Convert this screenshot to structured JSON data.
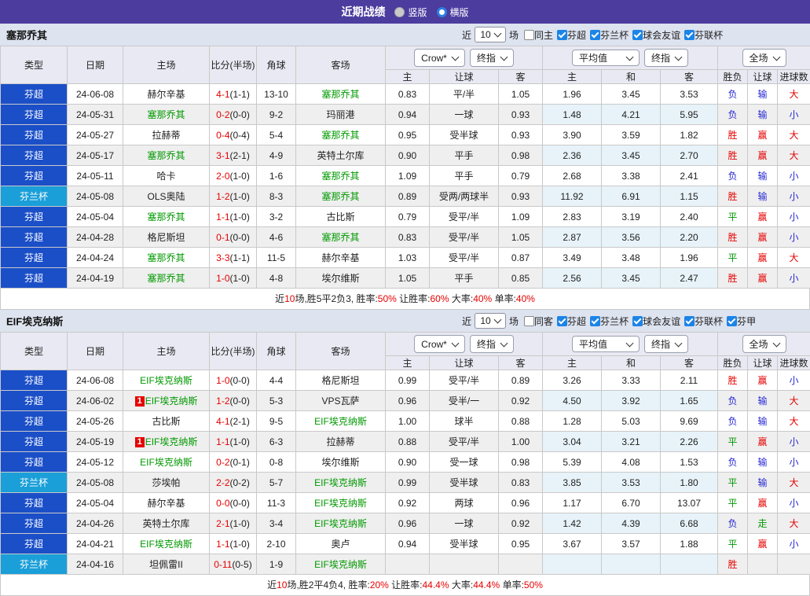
{
  "colors": {
    "titlebar_bg": "#4b3c9e",
    "league": {
      "芬超": "#1b4fc8",
      "芬兰杯": "#1a9fd8"
    },
    "team_highlight": "#009900",
    "score_red": "#e60000",
    "result_red": "#e60000",
    "result_blue": "#2727d4",
    "result_green": "#009900",
    "checkbox_blue": "#1b84e7",
    "avg_bg": "#e7f3f9",
    "stripe_bg": "#efefef",
    "filterbar_bg": "#dde3ef",
    "header_bg": "#e9e9f3"
  },
  "titlebar": {
    "title": "近期战绩",
    "radio_vertical": "竖版",
    "radio_horizontal": "横版"
  },
  "header": {
    "static_cols": [
      "类型",
      "日期",
      "主场",
      "比分(半场)",
      "角球",
      "客场"
    ],
    "groups": [
      {
        "dropdowns": [
          "Crow*",
          "终指"
        ],
        "sub": [
          "主",
          "让球",
          "客"
        ]
      },
      {
        "dropdowns": [
          "平均值",
          "终指"
        ],
        "sub": [
          "主",
          "和",
          "客"
        ]
      },
      {
        "dropdowns": [
          "全场"
        ],
        "sub": [
          "胜负",
          "让球",
          "进球数"
        ]
      }
    ]
  },
  "tables": [
    {
      "team": "塞那乔其",
      "filter": {
        "near": "近",
        "count": "10",
        "games": "场",
        "same": {
          "label": "同主",
          "checked": false
        },
        "leagues": [
          {
            "label": "芬超",
            "checked": true
          },
          {
            "label": "芬兰杯",
            "checked": true
          },
          {
            "label": "球会友谊",
            "checked": true
          },
          {
            "label": "芬联杯",
            "checked": true
          }
        ]
      },
      "rows": [
        {
          "league": "芬超",
          "date": "24-06-08",
          "home": "赫尔辛基",
          "score": "4-1",
          "half": "(1-1)",
          "corner": "13-10",
          "away": "塞那乔其",
          "odds": [
            "0.83",
            "平/半",
            "1.05"
          ],
          "avg": [
            "1.96",
            "3.45",
            "3.53"
          ],
          "result": [
            "负",
            "输",
            "大"
          ]
        },
        {
          "league": "芬超",
          "date": "24-05-31",
          "home": "塞那乔其",
          "score": "0-2",
          "half": "(0-0)",
          "corner": "9-2",
          "away": "玛丽港",
          "odds": [
            "0.94",
            "一球",
            "0.93"
          ],
          "avg": [
            "1.48",
            "4.21",
            "5.95"
          ],
          "result": [
            "负",
            "输",
            "小"
          ]
        },
        {
          "league": "芬超",
          "date": "24-05-27",
          "home": "拉赫蒂",
          "score": "0-4",
          "half": "(0-4)",
          "corner": "5-4",
          "away": "塞那乔其",
          "odds": [
            "0.95",
            "受半球",
            "0.93"
          ],
          "avg": [
            "3.90",
            "3.59",
            "1.82"
          ],
          "result": [
            "胜",
            "赢",
            "大"
          ]
        },
        {
          "league": "芬超",
          "date": "24-05-17",
          "home": "塞那乔其",
          "score": "3-1",
          "half": "(2-1)",
          "corner": "4-9",
          "away": "英特土尔库",
          "odds": [
            "0.90",
            "平手",
            "0.98"
          ],
          "avg": [
            "2.36",
            "3.45",
            "2.70"
          ],
          "result": [
            "胜",
            "赢",
            "大"
          ]
        },
        {
          "league": "芬超",
          "date": "24-05-11",
          "home": "哈卡",
          "score": "2-0",
          "half": "(1-0)",
          "corner": "1-6",
          "away": "塞那乔其",
          "odds": [
            "1.09",
            "平手",
            "0.79"
          ],
          "avg": [
            "2.68",
            "3.38",
            "2.41"
          ],
          "result": [
            "负",
            "输",
            "小"
          ]
        },
        {
          "league": "芬兰杯",
          "date": "24-05-08",
          "home": "OLS奥陆",
          "score": "1-2",
          "half": "(1-0)",
          "corner": "8-3",
          "away": "塞那乔其",
          "odds": [
            "0.89",
            "受两/两球半",
            "0.93"
          ],
          "avg": [
            "11.92",
            "6.91",
            "1.15"
          ],
          "result": [
            "胜",
            "输",
            "小"
          ]
        },
        {
          "league": "芬超",
          "date": "24-05-04",
          "home": "塞那乔其",
          "score": "1-1",
          "half": "(1-0)",
          "corner": "3-2",
          "away": "古比斯",
          "odds": [
            "0.79",
            "受平/半",
            "1.09"
          ],
          "avg": [
            "2.83",
            "3.19",
            "2.40"
          ],
          "result": [
            "平",
            "赢",
            "小"
          ]
        },
        {
          "league": "芬超",
          "date": "24-04-28",
          "home": "格尼斯坦",
          "score": "0-1",
          "half": "(0-0)",
          "corner": "4-6",
          "away": "塞那乔其",
          "odds": [
            "0.83",
            "受平/半",
            "1.05"
          ],
          "avg": [
            "2.87",
            "3.56",
            "2.20"
          ],
          "result": [
            "胜",
            "赢",
            "小"
          ]
        },
        {
          "league": "芬超",
          "date": "24-04-24",
          "home": "塞那乔其",
          "score": "3-3",
          "half": "(1-1)",
          "corner": "11-5",
          "away": "赫尔辛基",
          "odds": [
            "1.03",
            "受平/半",
            "0.87"
          ],
          "avg": [
            "3.49",
            "3.48",
            "1.96"
          ],
          "result": [
            "平",
            "赢",
            "大"
          ]
        },
        {
          "league": "芬超",
          "date": "24-04-19",
          "home": "塞那乔其",
          "score": "1-0",
          "half": "(1-0)",
          "corner": "4-8",
          "away": "埃尔维斯",
          "odds": [
            "1.05",
            "平手",
            "0.85"
          ],
          "avg": [
            "2.56",
            "3.45",
            "2.47"
          ],
          "result": [
            "胜",
            "赢",
            "小"
          ]
        }
      ],
      "summary": [
        {
          "t": "近"
        },
        {
          "t": "10",
          "red": true
        },
        {
          "t": "场,胜5平2负3, 胜率:"
        },
        {
          "t": "50%",
          "red": true
        },
        {
          "t": " 让胜率:"
        },
        {
          "t": "60%",
          "red": true
        },
        {
          "t": " 大率:"
        },
        {
          "t": "40%",
          "red": true
        },
        {
          "t": " 单率:"
        },
        {
          "t": "40%",
          "red": true
        }
      ]
    },
    {
      "team": "EIF埃克纳斯",
      "filter": {
        "near": "近",
        "count": "10",
        "games": "场",
        "same": {
          "label": "同客",
          "checked": false
        },
        "leagues": [
          {
            "label": "芬超",
            "checked": true
          },
          {
            "label": "芬兰杯",
            "checked": true
          },
          {
            "label": "球会友谊",
            "checked": true
          },
          {
            "label": "芬联杯",
            "checked": true
          },
          {
            "label": "芬甲",
            "checked": true
          }
        ]
      },
      "rows": [
        {
          "league": "芬超",
          "date": "24-06-08",
          "home": "EIF埃克纳斯",
          "score": "1-0",
          "half": "(0-0)",
          "corner": "4-4",
          "away": "格尼斯坦",
          "odds": [
            "0.99",
            "受平/半",
            "0.89"
          ],
          "avg": [
            "3.26",
            "3.33",
            "2.11"
          ],
          "result": [
            "胜",
            "赢",
            "小"
          ]
        },
        {
          "league": "芬超",
          "date": "24-06-02",
          "home": "EIF埃克纳斯",
          "home_badge": "1",
          "score": "1-2",
          "half": "(0-0)",
          "corner": "5-3",
          "away": "VPS瓦萨",
          "odds": [
            "0.96",
            "受半/一",
            "0.92"
          ],
          "avg": [
            "4.50",
            "3.92",
            "1.65"
          ],
          "result": [
            "负",
            "输",
            "大"
          ]
        },
        {
          "league": "芬超",
          "date": "24-05-26",
          "home": "古比斯",
          "score": "4-1",
          "half": "(2-1)",
          "corner": "9-5",
          "away": "EIF埃克纳斯",
          "odds": [
            "1.00",
            "球半",
            "0.88"
          ],
          "avg": [
            "1.28",
            "5.03",
            "9.69"
          ],
          "result": [
            "负",
            "输",
            "大"
          ]
        },
        {
          "league": "芬超",
          "date": "24-05-19",
          "home": "EIF埃克纳斯",
          "home_badge": "1",
          "score": "1-1",
          "half": "(1-0)",
          "corner": "6-3",
          "away": "拉赫蒂",
          "odds": [
            "0.88",
            "受平/半",
            "1.00"
          ],
          "avg": [
            "3.04",
            "3.21",
            "2.26"
          ],
          "result": [
            "平",
            "赢",
            "小"
          ]
        },
        {
          "league": "芬超",
          "date": "24-05-12",
          "home": "EIF埃克纳斯",
          "score": "0-2",
          "half": "(0-1)",
          "corner": "0-8",
          "away": "埃尔维斯",
          "odds": [
            "0.90",
            "受一球",
            "0.98"
          ],
          "avg": [
            "5.39",
            "4.08",
            "1.53"
          ],
          "result": [
            "负",
            "输",
            "小"
          ]
        },
        {
          "league": "芬兰杯",
          "date": "24-05-08",
          "home": "莎埃帕",
          "score": "2-2",
          "half": "(0-2)",
          "corner": "5-7",
          "away": "EIF埃克纳斯",
          "odds": [
            "0.99",
            "受半球",
            "0.83"
          ],
          "avg": [
            "3.85",
            "3.53",
            "1.80"
          ],
          "result": [
            "平",
            "输",
            "大"
          ]
        },
        {
          "league": "芬超",
          "date": "24-05-04",
          "home": "赫尔辛基",
          "score": "0-0",
          "half": "(0-0)",
          "corner": "11-3",
          "away": "EIF埃克纳斯",
          "odds": [
            "0.92",
            "两球",
            "0.96"
          ],
          "avg": [
            "1.17",
            "6.70",
            "13.07"
          ],
          "result": [
            "平",
            "赢",
            "小"
          ]
        },
        {
          "league": "芬超",
          "date": "24-04-26",
          "home": "英特土尔库",
          "score": "2-1",
          "half": "(1-0)",
          "corner": "3-4",
          "away": "EIF埃克纳斯",
          "odds": [
            "0.96",
            "一球",
            "0.92"
          ],
          "avg": [
            "1.42",
            "4.39",
            "6.68"
          ],
          "result": [
            "负",
            "走",
            "大"
          ]
        },
        {
          "league": "芬超",
          "date": "24-04-21",
          "home": "EIF埃克纳斯",
          "score": "1-1",
          "half": "(1-0)",
          "corner": "2-10",
          "away": "奥卢",
          "odds": [
            "0.94",
            "受半球",
            "0.95"
          ],
          "avg": [
            "3.67",
            "3.57",
            "1.88"
          ],
          "result": [
            "平",
            "赢",
            "小"
          ]
        },
        {
          "league": "芬兰杯",
          "date": "24-04-16",
          "home": "坦佩雷II",
          "score": "0-11",
          "half": "(0-5)",
          "corner": "1-9",
          "away": "EIF埃克纳斯",
          "odds": [
            "",
            "",
            ""
          ],
          "avg": [
            "",
            "",
            ""
          ],
          "result": [
            "胜",
            "",
            ""
          ]
        }
      ],
      "summary": [
        {
          "t": "近"
        },
        {
          "t": "10",
          "red": true
        },
        {
          "t": "场,胜2平4负4, 胜率:"
        },
        {
          "t": "20%",
          "red": true
        },
        {
          "t": " 让胜率:"
        },
        {
          "t": "44.4%",
          "red": true
        },
        {
          "t": " 大率:"
        },
        {
          "t": "44.4%",
          "red": true
        },
        {
          "t": " 单率:"
        },
        {
          "t": "50%",
          "red": true
        }
      ]
    }
  ]
}
